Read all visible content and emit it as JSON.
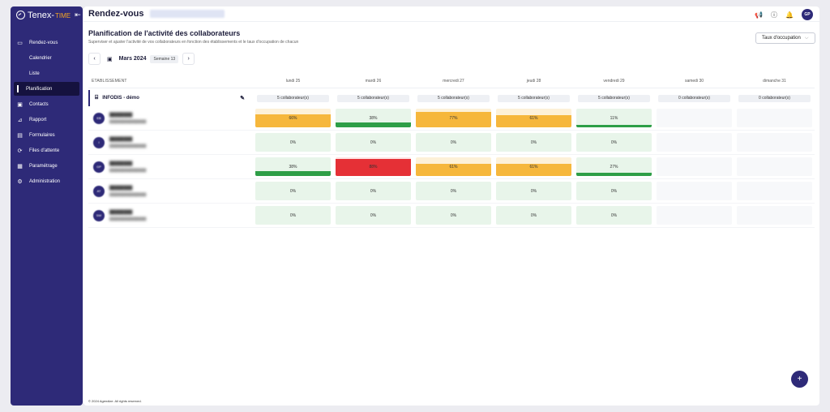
{
  "app": {
    "logo_text": "Tenex-",
    "logo_accent": "TIME",
    "collapse_icon": "collapse-icon"
  },
  "sidebar": {
    "items": [
      {
        "label": "Rendez-vous",
        "icon": "calendar-icon",
        "symbol": "▭"
      },
      {
        "label": "Calendrier",
        "sub": true
      },
      {
        "label": "Liste",
        "sub": true
      },
      {
        "label": "Planification",
        "sub": true,
        "active": true
      },
      {
        "label": "Contacts",
        "icon": "contacts-icon",
        "symbol": "▣"
      },
      {
        "label": "Rapport",
        "icon": "chart-icon",
        "symbol": "⊿"
      },
      {
        "label": "Formulaires",
        "icon": "form-icon",
        "symbol": "▤"
      },
      {
        "label": "Files d'attente",
        "icon": "queue-icon",
        "symbol": "⟳"
      },
      {
        "label": "Paramétrage",
        "icon": "settings-icon",
        "symbol": "▦"
      },
      {
        "label": "Administration",
        "icon": "gear-icon",
        "symbol": "⚙"
      }
    ]
  },
  "header": {
    "title": "Rendez-vous",
    "avatar": "GP"
  },
  "page": {
    "title": "Planification de l'activité des collaborateurs",
    "subtitle": "Superviser et ajuster l'activité de vos collaborateurs en fonction des établissements et le taux d'occupation de chacun",
    "rate_select": "Taux d'occupation",
    "month": "Mars 2024",
    "week": "Semaine 13"
  },
  "grid": {
    "establishment_header": "ETABLISSEMENT",
    "days": [
      "lundi 25",
      "mardi 26",
      "mercredi 27",
      "jeudi 28",
      "vendredi 29",
      "samedi 30",
      "dimanche 31"
    ],
    "establishment": {
      "name": "INFODIS - démo",
      "counts": [
        "5 collaborateur(s)",
        "5 collaborateur(s)",
        "5 collaborateur(s)",
        "5 collaborateur(s)",
        "5 collaborateur(s)",
        "0 collaborateur(s)",
        "0 collaborateur(s)"
      ]
    },
    "rows": [
      {
        "initials": "EB",
        "cells": [
          {
            "label": "66%",
            "value": 66
          },
          {
            "label": "38%",
            "value": 38
          },
          {
            "label": "77%",
            "value": 77
          },
          {
            "label": "61%",
            "value": 61
          },
          {
            "label": "11%",
            "value": 11
          },
          {
            "label": "",
            "value": null
          },
          {
            "label": "",
            "value": null
          }
        ]
      },
      {
        "initials": "I",
        "cells": [
          {
            "label": "0%",
            "value": 0
          },
          {
            "label": "0%",
            "value": 0
          },
          {
            "label": "0%",
            "value": 0
          },
          {
            "label": "0%",
            "value": 0
          },
          {
            "label": "0%",
            "value": 0
          },
          {
            "label": "",
            "value": null
          },
          {
            "label": "",
            "value": null
          }
        ]
      },
      {
        "initials": "GP",
        "cells": [
          {
            "label": "38%",
            "value": 38
          },
          {
            "label": "88%",
            "value": 88
          },
          {
            "label": "61%",
            "value": 61
          },
          {
            "label": "61%",
            "value": 61
          },
          {
            "label": "27%",
            "value": 27
          },
          {
            "label": "",
            "value": null
          },
          {
            "label": "",
            "value": null
          }
        ]
      },
      {
        "initials": "AT",
        "cells": [
          {
            "label": "0%",
            "value": 0
          },
          {
            "label": "0%",
            "value": 0
          },
          {
            "label": "0%",
            "value": 0
          },
          {
            "label": "0%",
            "value": 0
          },
          {
            "label": "0%",
            "value": 0
          },
          {
            "label": "",
            "value": null
          },
          {
            "label": "",
            "value": null
          }
        ]
      },
      {
        "initials": "SW",
        "cells": [
          {
            "label": "0%",
            "value": 0
          },
          {
            "label": "0%",
            "value": 0
          },
          {
            "label": "0%",
            "value": 0
          },
          {
            "label": "0%",
            "value": 0
          },
          {
            "label": "0%",
            "value": 0
          },
          {
            "label": "",
            "value": null
          },
          {
            "label": "",
            "value": null
          }
        ]
      }
    ]
  },
  "colors": {
    "low": "#2e9e47",
    "mid": "#f6b73c",
    "high": "#e53036",
    "primary": "#2e2a78"
  },
  "footer": "© 2024 Agendize. All rights reserved.",
  "fab_label": "+"
}
